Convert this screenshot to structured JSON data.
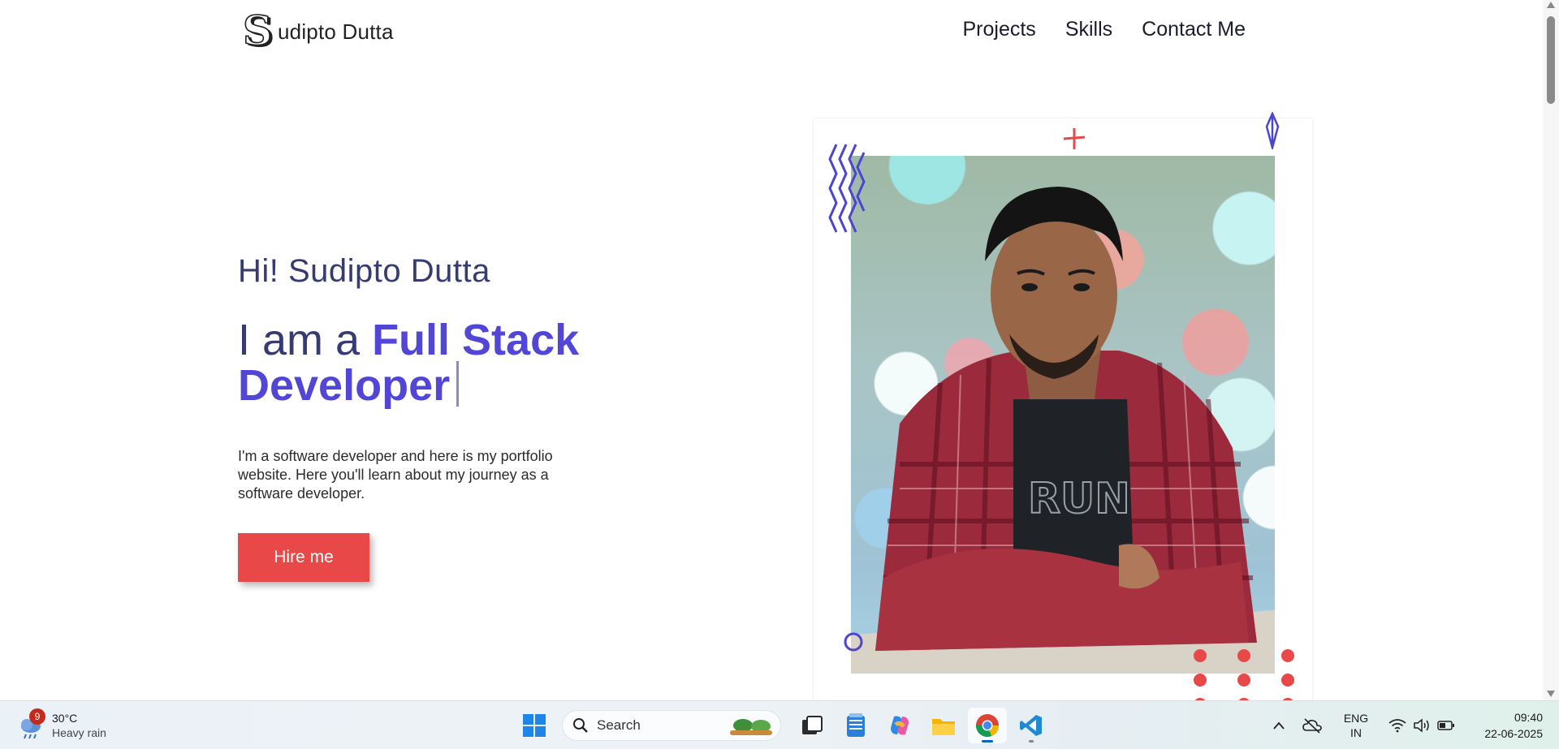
{
  "brand": {
    "logo_letter": "S",
    "name": "udipto Dutta"
  },
  "nav": {
    "items": [
      {
        "label": "Projects"
      },
      {
        "label": "Skills"
      },
      {
        "label": "Contact Me"
      }
    ]
  },
  "hero": {
    "greeting": "Hi! Sudipto Dutta",
    "headline_prefix": "I am a ",
    "headline_role": "Full Stack Developer",
    "intro": "I'm a software developer and here is my portfolio website. Here you'll learn about my journey as a software developer.",
    "cta_label": "Hire me"
  },
  "photo": {
    "alt_subject": "portrait photo",
    "shirt_text": "RUN"
  },
  "colors": {
    "accent": "#5146d6",
    "heading": "#363c72",
    "cta": "#e84848",
    "deco_red": "#e84848",
    "deco_blue": "#4b45d0"
  },
  "taskbar": {
    "weather": {
      "badge": "9",
      "temperature": "30°C",
      "condition": "Heavy rain"
    },
    "search_placeholder": "Search",
    "apps": [
      {
        "icon": "windows-start-icon"
      },
      {
        "icon": "task-view-icon"
      },
      {
        "icon": "notepad-icon"
      },
      {
        "icon": "copilot-icon"
      },
      {
        "icon": "file-explorer-icon"
      },
      {
        "icon": "chrome-icon"
      },
      {
        "icon": "vscode-icon"
      }
    ],
    "tray": {
      "language_line1": "ENG",
      "language_line2": "IN",
      "time": "09:40",
      "date": "22-06-2025"
    }
  }
}
